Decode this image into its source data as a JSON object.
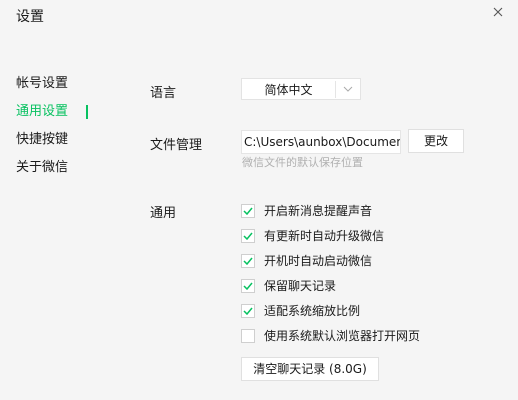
{
  "window": {
    "title": "设置"
  },
  "sidebar": {
    "items": [
      {
        "label": "帐号设置",
        "active": false
      },
      {
        "label": "通用设置",
        "active": true
      },
      {
        "label": "快捷按键",
        "active": false
      },
      {
        "label": "关于微信",
        "active": false
      }
    ]
  },
  "language": {
    "label": "语言",
    "value": "简体中文"
  },
  "file_management": {
    "label": "文件管理",
    "path": "C:\\Users\\aunbox\\Documents",
    "change_label": "更改",
    "hint": "微信文件的默认保存位置"
  },
  "general": {
    "label": "通用",
    "options": [
      {
        "label": "开启新消息提醒声音",
        "checked": true
      },
      {
        "label": "有更新时自动升级微信",
        "checked": true
      },
      {
        "label": "开机时自动启动微信",
        "checked": true
      },
      {
        "label": "保留聊天记录",
        "checked": true
      },
      {
        "label": "适配系统缩放比例",
        "checked": true
      },
      {
        "label": "使用系统默认浏览器打开网页",
        "checked": false
      }
    ],
    "clear_label": "清空聊天记录 (8.0G)"
  },
  "colors": {
    "accent": "#07c160",
    "check": "#07c160"
  }
}
